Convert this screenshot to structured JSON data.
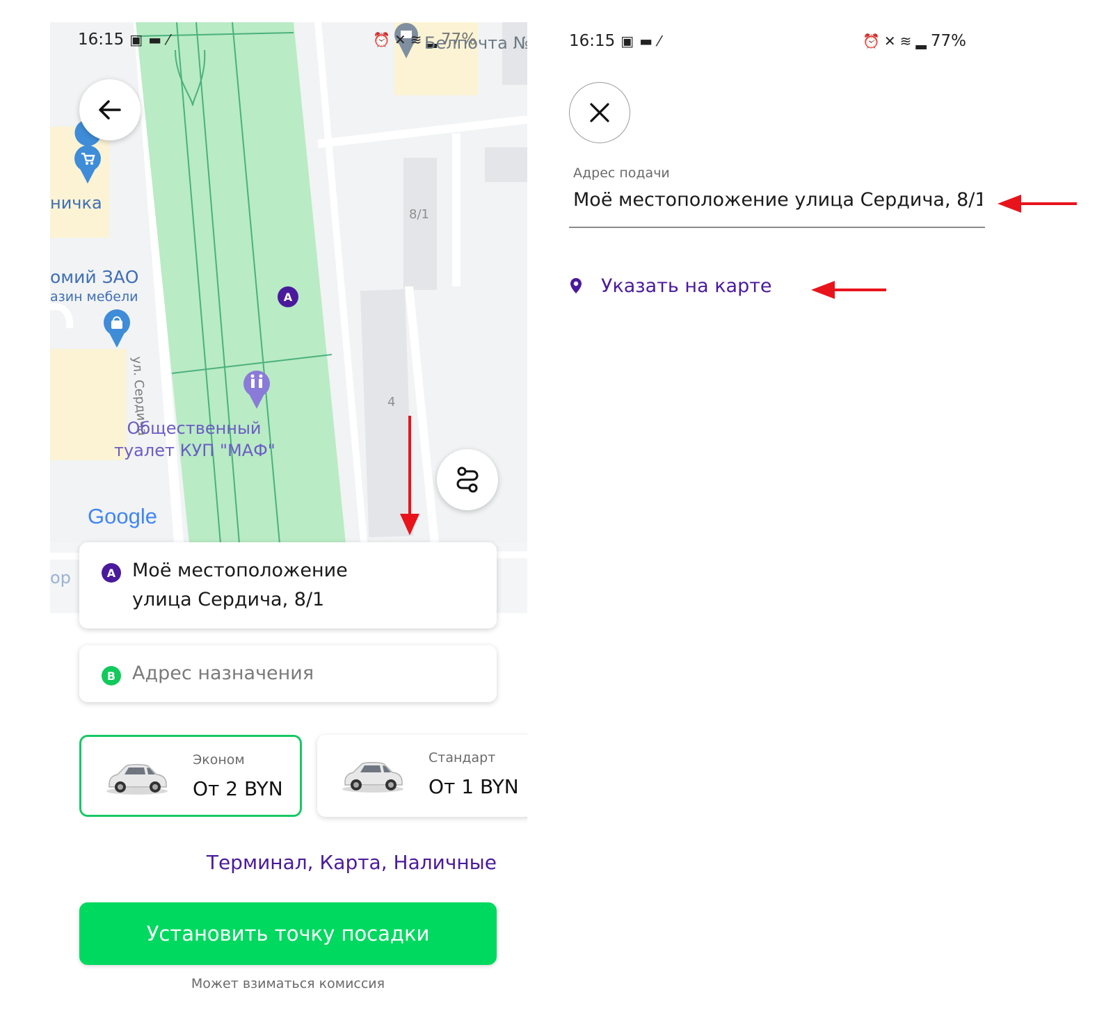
{
  "status_bar": {
    "time": "16:15",
    "battery": "77%"
  },
  "map": {
    "labels": {
      "poi_top_right": "Белпочта №",
      "shop_partial": "ничка",
      "furniture_line1": "омий ЗАО",
      "furniture_line2": "азин мебели",
      "street": "ул. Сердича",
      "building_8_1": "8/1",
      "building_4": "4",
      "toilet_line1": "Общественный",
      "toilet_line2": "туалет КУП \"МАФ\"",
      "partial_bottom": "ор",
      "google": "Google"
    },
    "marker_letter": "A"
  },
  "route": {
    "from": {
      "badge": "A",
      "line1": "Моё местоположение",
      "line2": "улица Сердича, 8/1"
    },
    "to": {
      "badge": "B",
      "placeholder": "Адрес назначения"
    }
  },
  "tariffs": [
    {
      "name": "Эконом",
      "price": "От 2 BYN",
      "selected": true
    },
    {
      "name": "Стандарт",
      "price": "От 1 BYN",
      "selected": false
    }
  ],
  "payment_methods": "Терминал, Карта, Наличные",
  "cta_label": "Установить точку посадки",
  "commission_note": "Может взиматься комиссия",
  "pickup_screen": {
    "field_label": "Адрес подачи",
    "field_value": "Моё местоположение улица Сердича, 8/1",
    "map_link": "Указать на карте"
  },
  "colors": {
    "brand_purple": "#4a1a9c",
    "brand_green": "#00d95f",
    "selected_border": "#18c864",
    "annotation_red": "#e8141c",
    "park_green": "#b9ebc5"
  },
  "icons": [
    "back-arrow-icon",
    "shopping-cart-pin-icon",
    "shopping-bag-pin-icon",
    "toilet-pin-icon",
    "route-options-icon",
    "close-icon",
    "location-pin-icon",
    "car-icon"
  ]
}
